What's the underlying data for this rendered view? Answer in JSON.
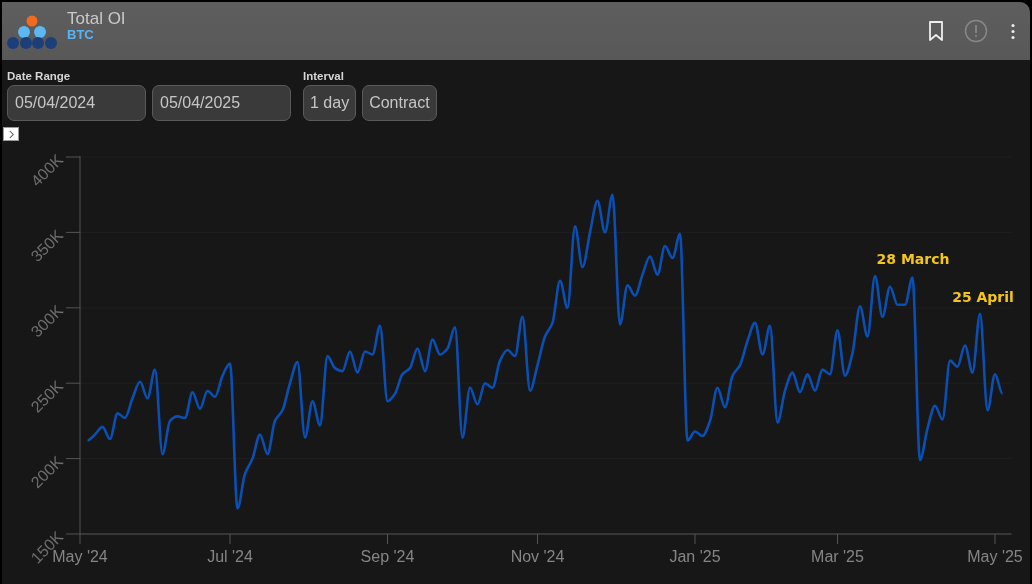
{
  "header": {
    "title": "Total OI",
    "subtitle": "BTC"
  },
  "controls": {
    "date_range": {
      "label": "Date Range",
      "start": "05/04/2024",
      "end": "05/04/2025"
    },
    "interval": {
      "label": "Interval",
      "value": "1 day"
    },
    "contract_button": "Contract"
  },
  "chart": {
    "chart_data": {
      "type": "line",
      "categories": [
        "May '24",
        null,
        null,
        null,
        null,
        null,
        null,
        null,
        null,
        null,
        null,
        null,
        null,
        null,
        null,
        null,
        null,
        null,
        null,
        null,
        "Jul '24",
        null,
        null,
        null,
        null,
        null,
        null,
        null,
        null,
        null,
        null,
        null,
        null,
        null,
        null,
        null,
        null,
        null,
        null,
        null,
        null,
        "Sep '24",
        null,
        null,
        null,
        null,
        null,
        null,
        null,
        null,
        null,
        null,
        null,
        null,
        null,
        null,
        null,
        null,
        null,
        null,
        null,
        "Nov '24",
        null,
        null,
        null,
        null,
        null,
        null,
        null,
        null,
        null,
        null,
        null,
        null,
        null,
        null,
        null,
        null,
        null,
        null,
        null,
        null,
        "Jan '25",
        null,
        null,
        null,
        null,
        null,
        null,
        null,
        null,
        null,
        null,
        null,
        null,
        null,
        null,
        null,
        null,
        null,
        null,
        "Mar '25",
        null,
        null,
        null,
        null,
        null,
        null,
        null,
        null,
        null,
        null,
        null,
        null,
        null,
        null,
        null,
        null,
        null,
        null,
        null,
        null,
        "May '25",
        null
      ],
      "series": [
        {
          "color": "#0a4fb4",
          "values": [
            null,
            212,
            216,
            221,
            213,
            230,
            227,
            240,
            251,
            240,
            259,
            203,
            225,
            228,
            227,
            244,
            233,
            245,
            241,
            255,
            263,
            167,
            190,
            200,
            216,
            203,
            225,
            232,
            250,
            264,
            214,
            238,
            222,
            268,
            260,
            258,
            271,
            257,
            271,
            269,
            288,
            238,
            243,
            256,
            260,
            273,
            258,
            279,
            269,
            273,
            287,
            214,
            247,
            236,
            250,
            247,
            265,
            272,
            268,
            294,
            245,
            262,
            281,
            290,
            318,
            300,
            354,
            327,
            350,
            371,
            350,
            375,
            289,
            315,
            308,
            322,
            334,
            322,
            341,
            333,
            349,
            212,
            218,
            215,
            225,
            247,
            234,
            255,
            262,
            278,
            290,
            269,
            288,
            224,
            245,
            257,
            244,
            256,
            245,
            259,
            256,
            285,
            255,
            270,
            301,
            281,
            321,
            294,
            314,
            302,
            302,
            320,
            199,
            220,
            235,
            226,
            265,
            261,
            275,
            257,
            296,
            232,
            256,
            243
          ]
        }
      ],
      "ylim": [
        150,
        400
      ],
      "yticks": [
        {
          "value": 150,
          "label": "150K"
        },
        {
          "value": 200,
          "label": "200K"
        },
        {
          "value": 250,
          "label": "250K"
        },
        {
          "value": 300,
          "label": "300K"
        },
        {
          "value": 350,
          "label": "350K"
        },
        {
          "value": 400,
          "label": "400K"
        }
      ],
      "annotations": [
        "28 March",
        "25 April"
      ]
    }
  }
}
